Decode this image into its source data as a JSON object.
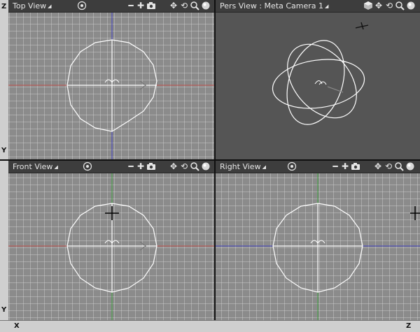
{
  "viewports": {
    "top": {
      "title": "Top View"
    },
    "pers": {
      "title": "Pers View : Meta Camera 1"
    },
    "front": {
      "title": "Front View"
    },
    "right": {
      "title": "Right View"
    }
  },
  "rulers": {
    "top_left_letters": [
      "Z",
      "Y"
    ],
    "bottom_left_letters": [
      "Y",
      "X"
    ],
    "bottom_right_letter": "Z"
  },
  "icons": {
    "camera_target": "target-icon",
    "move": "move-icon",
    "zoom_in": "plus-icon",
    "zoom_out": "minus-icon",
    "camera": "camera-icon",
    "pan": "pan-icon",
    "rotate": "rotate-icon",
    "zoom": "magnifier-icon",
    "shading": "sphere-icon",
    "box": "box-icon"
  },
  "colors": {
    "grid_bg": "#8b8b8b",
    "pers_bg": "#555555",
    "axis_red": "#c0504d",
    "axis_blue": "#4040c0",
    "axis_green": "#3fa33f",
    "wire": "#ffffff"
  }
}
